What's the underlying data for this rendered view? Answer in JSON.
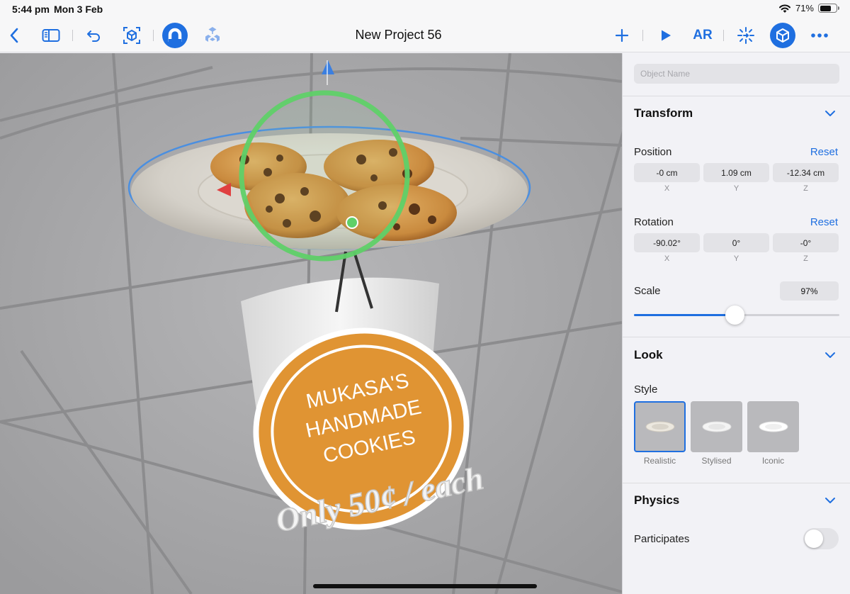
{
  "status": {
    "time": "5:44 pm",
    "date": "Mon 3 Feb",
    "battery_pct": "71%",
    "battery_level": 0.71
  },
  "toolbar": {
    "title": "New Project 56",
    "ar_label": "AR",
    "icons": [
      "chevron-left-icon",
      "sidebar-icon",
      "undo-icon",
      "ar-cube-icon",
      "magnet-icon",
      "cube-stack-icon",
      "plus-icon",
      "play-icon",
      "move-icon",
      "cube-icon",
      "more-icon"
    ],
    "accent": "#1f6fe0"
  },
  "scene": {
    "sign_lines": [
      "MUKASA'S",
      "HANDMADE",
      "COOKIES"
    ],
    "floating_text": "Only 50¢ / each",
    "sign_color": "#e09433",
    "gizmo_ring_color": "#5fd068",
    "selection_outline_color": "#4b8fe0"
  },
  "inspector": {
    "object_name_placeholder": "Object Name",
    "transform": {
      "title": "Transform",
      "position_label": "Position",
      "rotation_label": "Rotation",
      "reset_label": "Reset",
      "position": {
        "x": "-0 cm",
        "y": "1.09 cm",
        "z": "-12.34 cm"
      },
      "rotation": {
        "x": "-90.02°",
        "y": "0°",
        "z": "-0°"
      },
      "axes": {
        "x": "X",
        "y": "Y",
        "z": "Z"
      },
      "scale_label": "Scale",
      "scale_value": "97%",
      "scale_slider": 0.49
    },
    "look": {
      "title": "Look",
      "style_label": "Style",
      "styles": [
        {
          "label": "Realistic",
          "selected": true
        },
        {
          "label": "Stylised",
          "selected": false
        },
        {
          "label": "Iconic",
          "selected": false
        }
      ]
    },
    "physics": {
      "title": "Physics",
      "participates_label": "Participates",
      "participates_on": false
    }
  }
}
